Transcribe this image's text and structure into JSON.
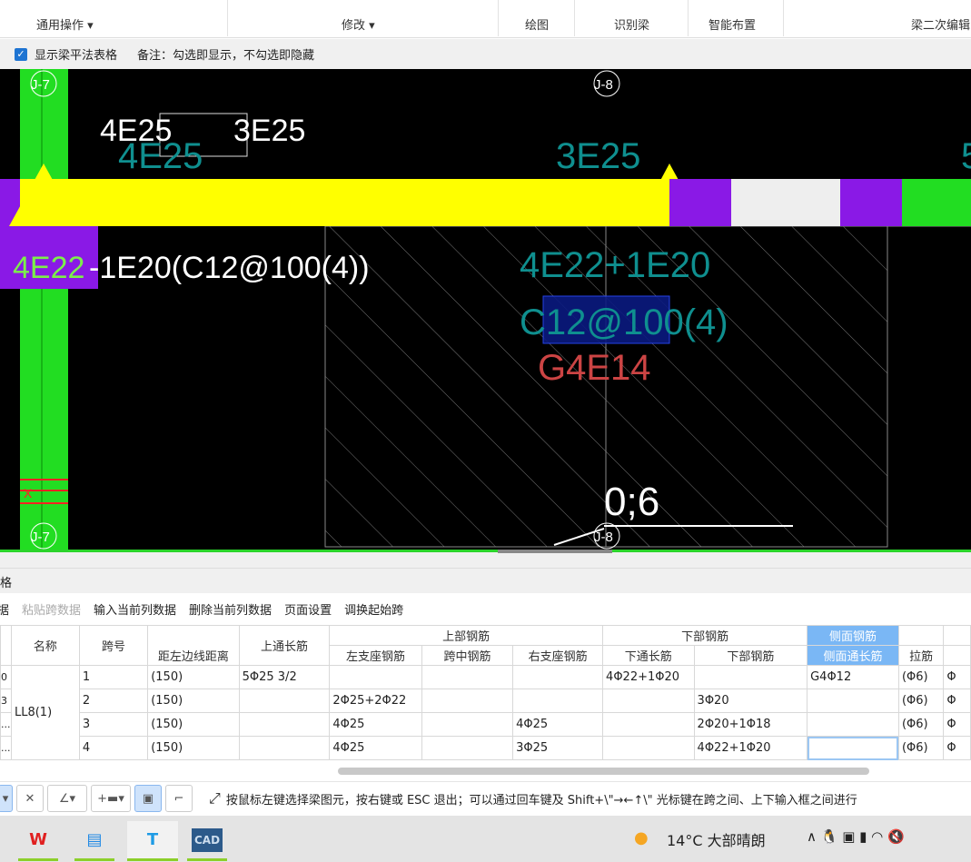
{
  "ribbon": {
    "groups": [
      "通用操作 ▾",
      "修改 ▾",
      "绘图",
      "识别梁",
      "智能布置",
      "梁二次编辑"
    ]
  },
  "options": {
    "show_table_label": "显示梁平法表格",
    "show_table_checked": true,
    "note": "备注：勾选即显示，不勾选即隐藏"
  },
  "canvas": {
    "axes": [
      "J-7",
      "J-8",
      "J-7",
      "J-8"
    ],
    "top_left_label": "4E25",
    "top_right_label": "3E25",
    "ghost_top_left": "4E25",
    "ghost_top_mid": "3E25",
    "ghost_right": "5",
    "left_span_green": "4E22",
    "left_span_white": "-1E20(C12@100(4))",
    "mid_bottom": "4E22+1E20",
    "mid_stirrup": "C12@100(4)",
    "mid_side": "G4E14",
    "cursor_text": "0;6",
    "marker": "X"
  },
  "panel": {
    "title": "格"
  },
  "table_toolbar": [
    "据",
    "粘贴跨数据",
    "输入当前列数据",
    "删除当前列数据",
    "页面设置",
    "调换起始跨"
  ],
  "table": {
    "headers_top": {
      "name": "名称",
      "span": "跨号",
      "top_through": "上通长筋",
      "top_steel": "上部钢筋",
      "bottom_steel": "下部钢筋",
      "side_steel": "侧面钢筋"
    },
    "headers_sub": [
      "距左边线距离",
      "左支座钢筋",
      "跨中钢筋",
      "右支座钢筋",
      "下通长筋",
      "下部钢筋",
      "侧面通长筋",
      "拉筋"
    ],
    "beam_name": "LL8(1)",
    "left_clip": [
      "0",
      "3",
      "..."
    ],
    "rows": [
      {
        "span": "1",
        "dist": "(150)",
        "top_through": "5Φ25 3/2",
        "left": "",
        "mid": "",
        "right": "",
        "bot_through": "4Φ22+1Φ20",
        "bottom": "",
        "side": "G4Φ12",
        "tie": "(Φ6)",
        "extra": "Φ"
      },
      {
        "span": "2",
        "dist": "(150)",
        "top_through": "",
        "left": "2Φ25+2Φ22",
        "mid": "",
        "right": "",
        "bot_through": "",
        "bottom": "3Φ20",
        "side": "",
        "tie": "(Φ6)",
        "extra": "Φ"
      },
      {
        "span": "3",
        "dist": "(150)",
        "top_through": "",
        "left": "4Φ25",
        "mid": "",
        "right": "4Φ25",
        "bot_through": "",
        "bottom": "2Φ20+1Φ18",
        "side": "",
        "tie": "(Φ6)",
        "extra": "Φ"
      },
      {
        "span": "4",
        "dist": "(150)",
        "top_through": "",
        "left": "4Φ25",
        "mid": "",
        "right": "3Φ25",
        "bot_through": "",
        "bottom": "4Φ22+1Φ20",
        "side": "",
        "tie": "(Φ6)",
        "extra": "Φ"
      }
    ]
  },
  "status": {
    "hint": "按鼠标左键选择梁图元，按右键或 ESC 退出；可以通过回车键及 Shift+\\\"→←↑\\\" 光标键在跨之间、上下输入框之间进行"
  },
  "taskbar": {
    "apps": [
      "W",
      "T"
    ],
    "weather": "14°C  大部晴朗",
    "cad": "CAD"
  },
  "colors": {
    "beam": "#ffff00",
    "column": "#22dd22",
    "purple": "#8a19e6",
    "teal": "#0f8f8f",
    "highlight": "#7ab7f5"
  }
}
